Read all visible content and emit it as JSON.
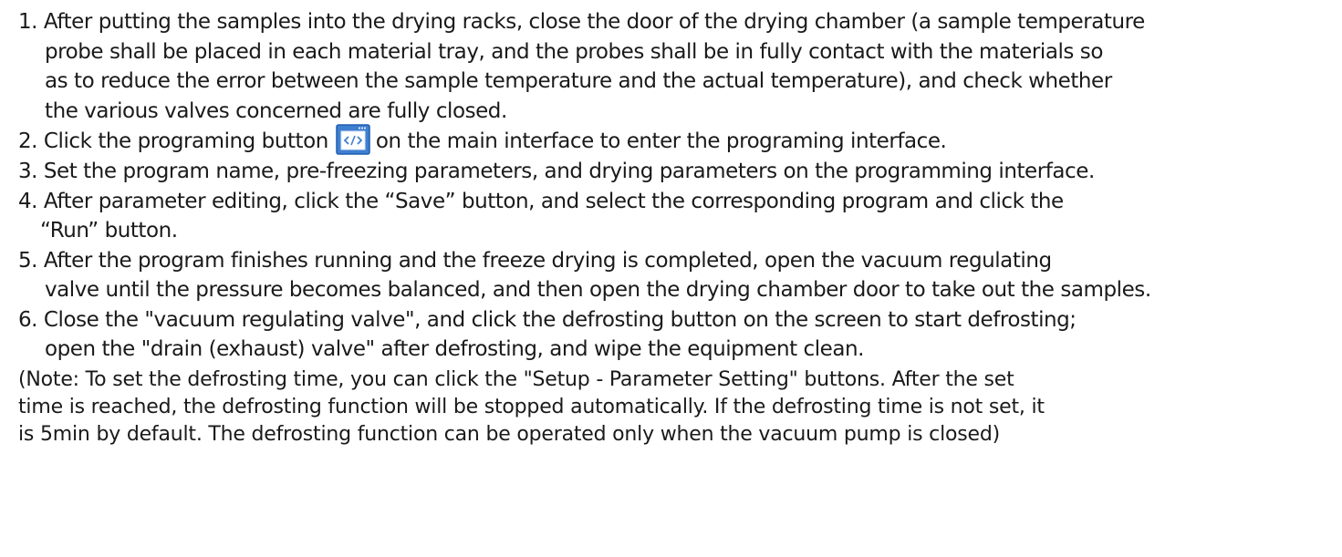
{
  "steps": [
    {
      "lines": [
        "1. After putting the samples into the drying racks, close the door of the drying chamber (a sample temperature",
        "probe shall be placed in each material tray, and the probes shall be in fully contact with the materials so",
        "as to reduce the error between the sample temperature and the actual temperature), and check whether",
        "the various valves concerned are fully closed."
      ]
    },
    {
      "before_icon": "2. Click the programing button",
      "icon": "programming-button-icon",
      "after_icon": "on the main interface to enter the programing interface."
    },
    {
      "lines": [
        "3. Set the program name, pre-freezing parameters, and drying parameters on the programming interface."
      ]
    },
    {
      "lines": [
        "4. After parameter editing, click the “Save” button, and select the corresponding program and click the",
        "“Run” button."
      ]
    },
    {
      "lines": [
        "5. After the program finishes running and the freeze drying is completed, open the vacuum regulating",
        "valve until the pressure becomes balanced, and then open the drying chamber door to take out the samples."
      ]
    },
    {
      "lines": [
        "6. Close the \"vacuum regulating valve\", and click the defrosting button on the screen to start defrosting;",
        "open the \"drain (exhaust) valve\" after defrosting, and wipe the equipment clean."
      ]
    }
  ],
  "note": [
    "(Note: To set the defrosting time, you can click the \"Setup - Parameter Setting\" buttons. After the set",
    "time is reached, the defrosting function will be stopped automatically. If the defrosting time is not set, it",
    "is 5min by default. The defrosting function can be operated only when the vacuum pump is closed)"
  ],
  "colors": {
    "text": "#1a1a1a",
    "icon_fill": "#3f7fd0",
    "icon_border": "#1f5fb0"
  }
}
